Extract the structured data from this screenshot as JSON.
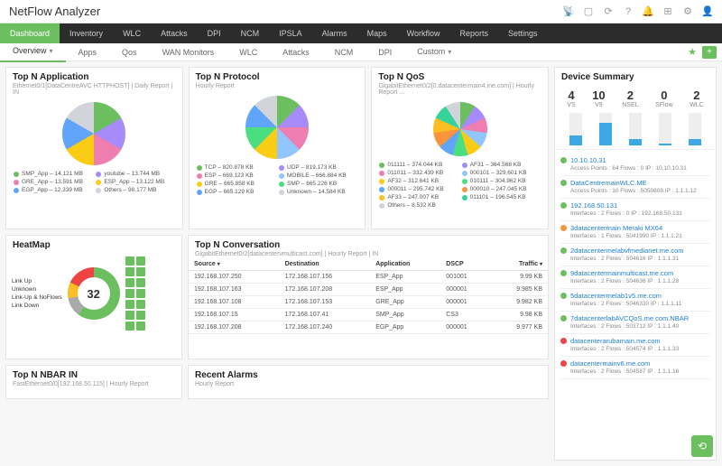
{
  "brand": "NetFlow Analyzer",
  "main_nav": [
    "Dashboard",
    "Inventory",
    "WLC",
    "Attacks",
    "DPI",
    "NCM",
    "IPSLA",
    "Alarms",
    "Maps",
    "Workflow",
    "Reports",
    "Settings"
  ],
  "sub_nav": [
    "Overview",
    "Apps",
    "Qos",
    "WAN Monitors",
    "WLC",
    "Attacks",
    "NCM",
    "DPI",
    "Custom"
  ],
  "sub_active": "Overview",
  "app_card": {
    "title": "Top N Application",
    "sub": "Ethernet0/1[DataCentreAVC HTTPHOST] | Daily Report | IN",
    "items": [
      {
        "label": "SMP_App – 14.121 MB",
        "color": "#6cbf5f"
      },
      {
        "label": "youtube – 13.744 MB",
        "color": "#a78bfa"
      },
      {
        "label": "GRE_App – 13.591 MB",
        "color": "#ef7eb0"
      },
      {
        "label": "ESP_App – 13.122 MB",
        "color": "#facc15"
      },
      {
        "label": "EGP_App – 12.339 MB",
        "color": "#60a5fa"
      },
      {
        "label": "Others – 98.177 MB",
        "color": "#d1d5db"
      }
    ]
  },
  "proto_card": {
    "title": "Top N Protocol",
    "sub": "Hourly Report",
    "items": [
      {
        "label": "TCP – 820.878 KB",
        "color": "#6cbf5f"
      },
      {
        "label": "UDP – 819.173 KB",
        "color": "#a78bfa"
      },
      {
        "label": "ESP – 669.123 KB",
        "color": "#ef7eb0"
      },
      {
        "label": "MOBILE – 666.884 KB",
        "color": "#93c5fd"
      },
      {
        "label": "GRE – 665.858 KB",
        "color": "#facc15"
      },
      {
        "label": "SMP – 665.226 KB",
        "color": "#4ade80"
      },
      {
        "label": "EGP – 665.129 KB",
        "color": "#60a5fa"
      },
      {
        "label": "Unknown – 14.584 KB",
        "color": "#d1d5db"
      }
    ]
  },
  "qos_card": {
    "title": "Top N QoS",
    "sub": "GigabitEthernet0/2[0.datacentermain4.ine.com] | Hourly Report ...",
    "items": [
      {
        "label": "011111 – 374.044 KB",
        "color": "#6cbf5f"
      },
      {
        "label": "AF31 – 364.568 KB",
        "color": "#a78bfa"
      },
      {
        "label": "011011 – 332.439 KB",
        "color": "#ef7eb0"
      },
      {
        "label": "000101 – 329.601 KB",
        "color": "#93c5fd"
      },
      {
        "label": "AF32 – 312.641 KB",
        "color": "#facc15"
      },
      {
        "label": "010111 – 304.962 KB",
        "color": "#4ade80"
      },
      {
        "label": "000011 – 295.742 KB",
        "color": "#60a5fa"
      },
      {
        "label": "000010 – 247.045 KB",
        "color": "#fb923c"
      },
      {
        "label": "AF33 – 247.007 KB",
        "color": "#fbbf24"
      },
      {
        "label": "011101 – 196.545 KB",
        "color": "#34d399"
      },
      {
        "label": "Others – 8.532 KB",
        "color": "#d1d5db"
      }
    ]
  },
  "heatmap": {
    "title": "HeatMap",
    "legend": [
      "Link Up",
      "Unknown",
      "Link-Up & NoFlows",
      "Link Down"
    ],
    "count": "32"
  },
  "conv": {
    "title": "Top N Conversation",
    "sub": "GigabitEthernet0/2[datacentervmulticast.com] | Hourly Report | IN",
    "cols": [
      "Source",
      "Destination",
      "Application",
      "DSCP",
      "Traffic"
    ],
    "rows": [
      [
        "192.168.107.250",
        "172.168.107.156",
        "ESP_App",
        "001001",
        "9.99 KB"
      ],
      [
        "192.168.107.163",
        "172.168.107.208",
        "ESP_App",
        "000001",
        "9.985 KB"
      ],
      [
        "192.168.107.108",
        "172.168.107.153",
        "GRE_App",
        "000001",
        "9.982 KB"
      ],
      [
        "192.168.107.15",
        "172.168.107.41",
        "SMP_App",
        "CS3",
        "9.98 KB"
      ],
      [
        "192.168.107.208",
        "172.168.107.240",
        "EGP_App",
        "000001",
        "9.977 KB"
      ]
    ]
  },
  "nbar": {
    "title": "Top N NBAR IN",
    "sub": "FastEthernet0/0[192.168.50.115] | Hourly Report"
  },
  "recent": {
    "title": "Recent Alarms",
    "sub": "Hourly Report"
  },
  "summary": {
    "title": "Device Summary",
    "stats": [
      {
        "n": "4",
        "l": "VS"
      },
      {
        "n": "10",
        "l": "V9"
      },
      {
        "n": "2",
        "l": "NSEL"
      },
      {
        "n": "0",
        "l": "SFlow"
      },
      {
        "n": "2",
        "l": "WLC"
      }
    ],
    "bar_pct": [
      30,
      70,
      20,
      5,
      20
    ]
  },
  "devices": [
    {
      "c": "#6cbf5f",
      "n": "10.10.10.31",
      "s": "Access Points : 64    Flows : 0    IP : 10.10.10.31"
    },
    {
      "c": "#6cbf5f",
      "n": "DataCentremainWLC.ME",
      "s": "Access Points : 10    Flows : 5050808    IP : 1.1.1.12"
    },
    {
      "c": "#6cbf5f",
      "n": "192.168.50.131",
      "s": "Interfaces : 2    Flows : 0    IP : 192.168.50.131"
    },
    {
      "c": "#fb923c",
      "n": "3datacentermain Meraki MX64",
      "s": "Interfaces : 1    Flows : 5041990    IP : 1.1.1.21"
    },
    {
      "c": "#6cbf5f",
      "n": "2datacentermelabvfmedianet.me.com",
      "s": "Interfaces : 2    Flows : 504616    IP : 1.1.1.31"
    },
    {
      "c": "#6cbf5f",
      "n": "9datacentermainmulticast.me.com",
      "s": "Interfaces : 2    Flows : 504636    IP : 1.1.1.28"
    },
    {
      "c": "#6cbf5f",
      "n": "5datacentermelab1v5.me.com",
      "s": "Interfaces : 2    Flows : 5046330    IP : 1.1.1.11"
    },
    {
      "c": "#6cbf5f",
      "n": "7datacenterlabAVCQoS.me.com.NBAR",
      "s": "Interfaces : 2    Flows : 503712    IP : 1.1.1.40"
    },
    {
      "c": "#ef4444",
      "n": "datacenterarubamain.me.com",
      "s": "Interfaces : 2    Flows : 504574    IP : 1.1.1.33"
    },
    {
      "c": "#ef4444",
      "n": "datacentermainv6.me.com",
      "s": "Interfaces : 2    Flows : 504587    IP : 1.1.1.16"
    }
  ],
  "chart_data": [
    {
      "type": "pie",
      "title": "Top N Application",
      "series": [
        {
          "name": "SMP_App",
          "value": 14.121
        },
        {
          "name": "youtube",
          "value": 13.744
        },
        {
          "name": "GRE_App",
          "value": 13.591
        },
        {
          "name": "ESP_App",
          "value": 13.122
        },
        {
          "name": "EGP_App",
          "value": 12.339
        },
        {
          "name": "Others",
          "value": 98.177
        }
      ],
      "unit": "MB"
    },
    {
      "type": "pie",
      "title": "Top N Protocol",
      "series": [
        {
          "name": "TCP",
          "value": 820.878
        },
        {
          "name": "UDP",
          "value": 819.173
        },
        {
          "name": "ESP",
          "value": 669.123
        },
        {
          "name": "MOBILE",
          "value": 666.884
        },
        {
          "name": "GRE",
          "value": 665.858
        },
        {
          "name": "SMP",
          "value": 665.226
        },
        {
          "name": "EGP",
          "value": 665.129
        },
        {
          "name": "Unknown",
          "value": 14.584
        }
      ],
      "unit": "KB"
    },
    {
      "type": "pie",
      "title": "Top N QoS",
      "series": [
        {
          "name": "011111",
          "value": 374.044
        },
        {
          "name": "AF31",
          "value": 364.568
        },
        {
          "name": "011011",
          "value": 332.439
        },
        {
          "name": "000101",
          "value": 329.601
        },
        {
          "name": "AF32",
          "value": 312.641
        },
        {
          "name": "010111",
          "value": 304.962
        },
        {
          "name": "000011",
          "value": 295.742
        },
        {
          "name": "000010",
          "value": 247.045
        },
        {
          "name": "AF33",
          "value": 247.007
        },
        {
          "name": "011101",
          "value": 196.545
        },
        {
          "name": "Others",
          "value": 8.532
        }
      ],
      "unit": "KB"
    },
    {
      "type": "pie",
      "title": "HeatMap",
      "series": [
        {
          "name": "Link Up",
          "value": 60
        },
        {
          "name": "Unknown",
          "value": 12
        },
        {
          "name": "Link-Up & NoFlows",
          "value": 10
        },
        {
          "name": "Link Down",
          "value": 18
        }
      ],
      "total": 32
    },
    {
      "type": "bar",
      "title": "Device Summary",
      "categories": [
        "VS",
        "V9",
        "NSEL",
        "SFlow",
        "WLC"
      ],
      "values": [
        4,
        10,
        2,
        0,
        2
      ]
    }
  ]
}
